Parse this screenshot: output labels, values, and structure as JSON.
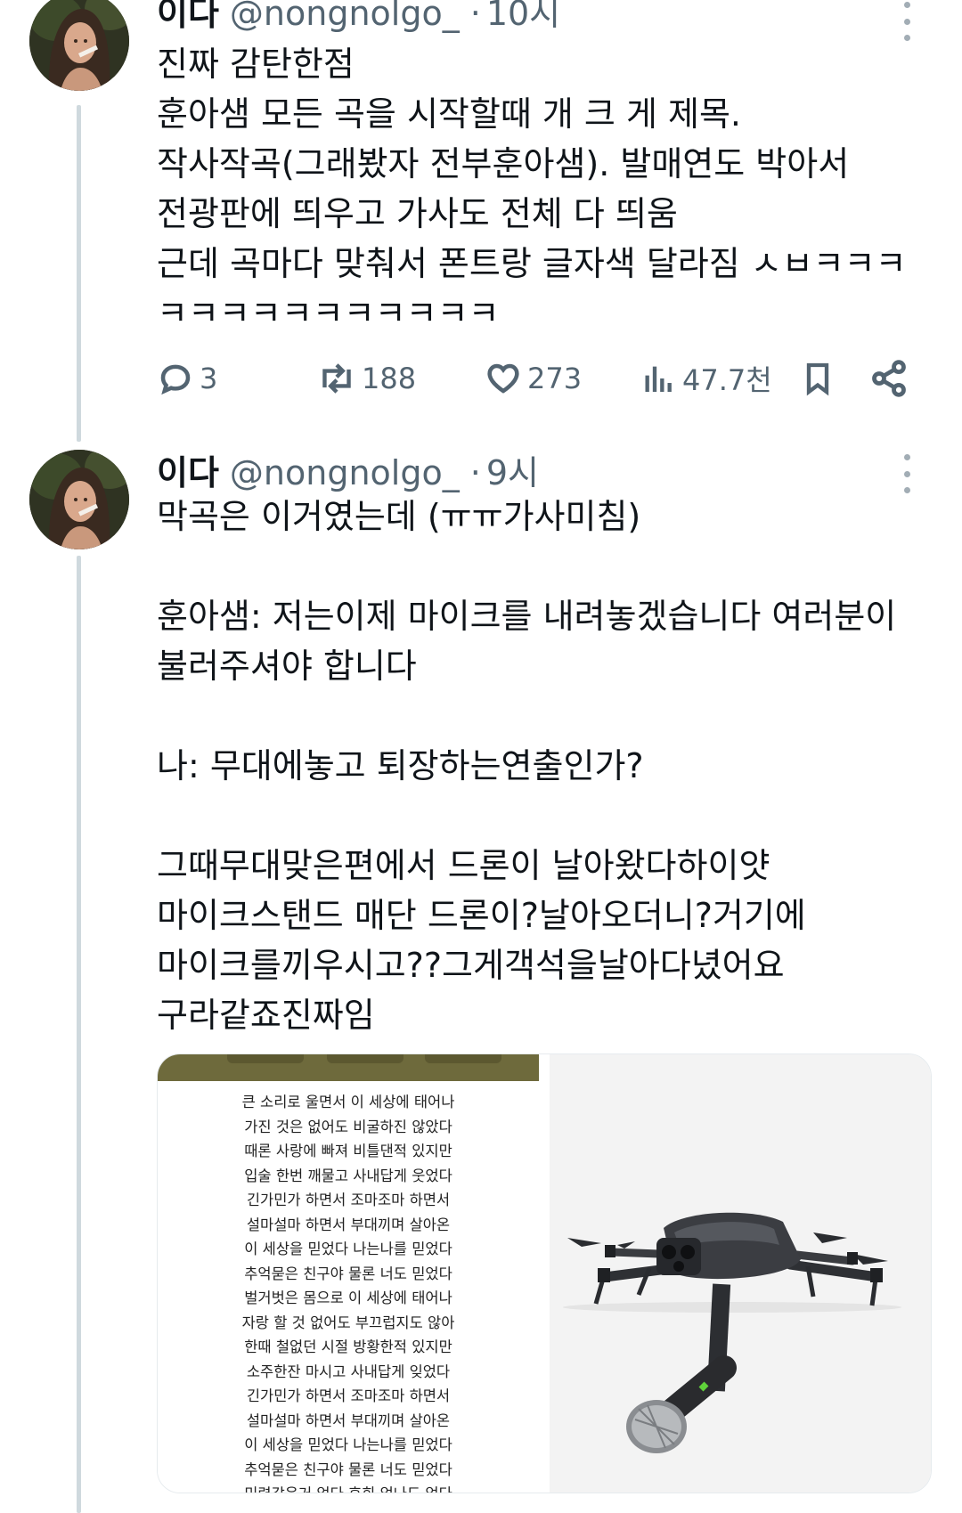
{
  "tweets": [
    {
      "name": "이다",
      "handle": "@nongnolgo_",
      "separator": "·",
      "time": "10시",
      "lines": [
        "진짜 감탄한점",
        "훈아샘 모든 곡을 시작할때 개 크 게 제목.",
        "작사작곡(그래봤자 전부훈아샘). 발매연도 박아서",
        "전광판에 띄우고 가사도 전체 다 띄움",
        "근데 곡마다 맞춰서 폰트랑 글자색 달라짐 ㅅㅂㅋㅋㅋ",
        "ㅋㅋㅋㅋㅋㅋㅋㅋㅋㅋㅋ"
      ],
      "actions": {
        "reply_count": "3",
        "retweet_count": "188",
        "like_count": "273",
        "view_count": "47.7천"
      }
    },
    {
      "name": "이다",
      "handle": "@nongnolgo_",
      "separator": "·",
      "time": "9시",
      "lines": [
        "막곡은 이거였는데 (ㅠㅠ가사미침)",
        "",
        "훈아샘: 저는이제 마이크를 내려놓겠습니다 여러분이",
        "불러주셔야 합니다",
        "",
        "나: 무대에놓고 퇴장하는연출인가?",
        "",
        "그때무대맞은편에서 드론이 날아왔다하이얏",
        "마이크스탠드 매단 드론이?날아오더니?거기에",
        "마이크를끼우시고??그게객석을날아다녔어요",
        "구라같죠진짜임"
      ],
      "lyrics": [
        "큰 소리로 울면서 이 세상에 태어나",
        "가진 것은 없어도 비굴하진 않았다",
        "때론 사랑에 빠져 비틀댄적 있지만",
        "입술 한번 깨물고 사내답게 웃었다",
        "긴가민가 하면서 조마조마 하면서",
        "설마설마 하면서 부대끼며 살아온",
        "이 세상을 믿었다 나는나를 믿었다",
        "추억묻은 친구야 물론 너도 믿었다",
        "벌거벗은 몸으로 이 세상에 태어나",
        "자랑 할 것 없어도 부끄럽지도 않아",
        "한때 철없던 시절 방황한적 있지만",
        "소주한잔 마시고 사내답게 잊었다",
        "긴가민가 하면서 조마조마 하면서",
        "설마설마 하면서 부대끼며 살아온",
        "이 세상을 믿었다 나는나를 믿었다",
        "추억묻은 친구야 물론 너도 믿었다",
        "미련같은거 없다 후회 없나도 없다"
      ]
    }
  ],
  "colors": {
    "text": "#0f1419",
    "secondary": "#536471",
    "thread_line": "#cfd9de"
  }
}
